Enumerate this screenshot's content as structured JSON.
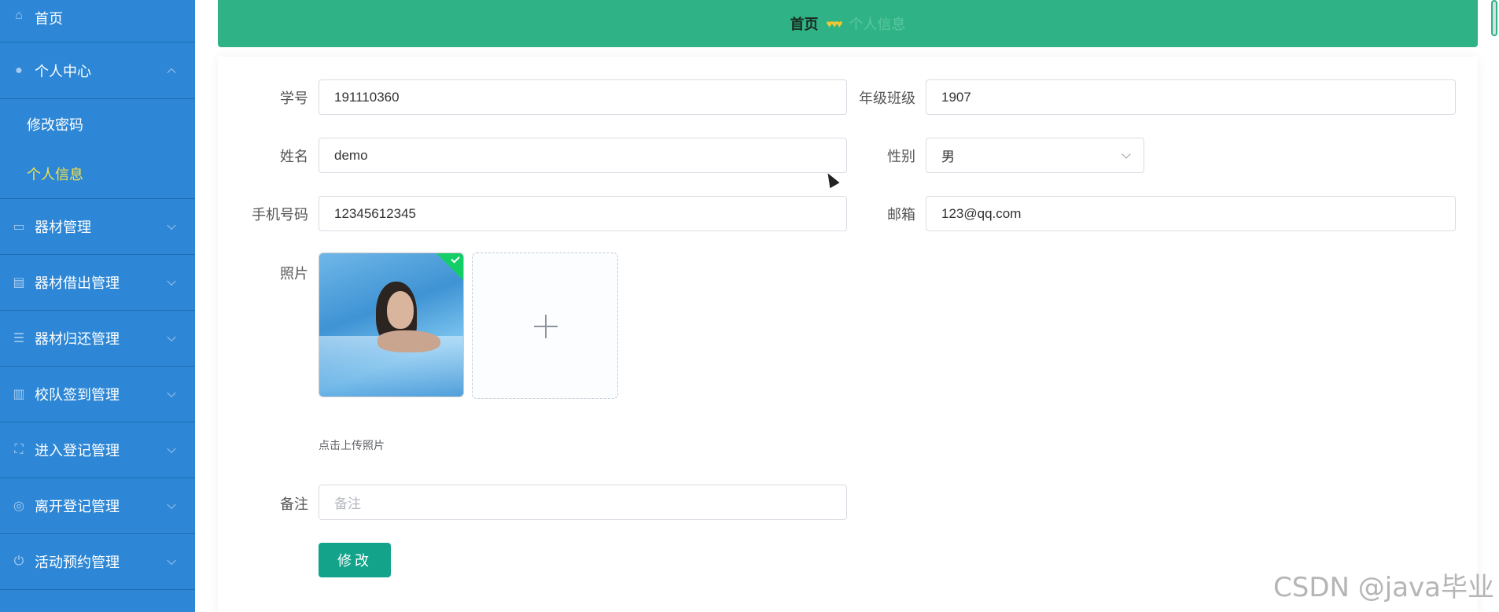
{
  "sidebar": {
    "items": [
      {
        "label": "首页",
        "icon": "home-icon"
      },
      {
        "label": "个人中心",
        "icon": "user-icon",
        "expanded": true,
        "children": [
          {
            "label": "修改密码"
          },
          {
            "label": "个人信息",
            "active": true
          }
        ]
      },
      {
        "label": "器材管理",
        "icon": "monitor-icon"
      },
      {
        "label": "器材借出管理",
        "icon": "clipboard-icon"
      },
      {
        "label": "器材归还管理",
        "icon": "sliders-icon"
      },
      {
        "label": "校队签到管理",
        "icon": "books-icon"
      },
      {
        "label": "进入登记管理",
        "icon": "fullscreen-icon"
      },
      {
        "label": "离开登记管理",
        "icon": "lifebuoy-icon"
      },
      {
        "label": "活动预约管理",
        "icon": "power-icon"
      }
    ]
  },
  "breadcrumb": {
    "home": "首页",
    "separator": "♥♥♥",
    "current": "个人信息"
  },
  "form": {
    "student_id": {
      "label": "学号",
      "value": "191110360"
    },
    "grade_class": {
      "label": "年级班级",
      "value": "1907"
    },
    "name": {
      "label": "姓名",
      "value": "demo"
    },
    "gender": {
      "label": "性别",
      "value": "男"
    },
    "phone": {
      "label": "手机号码",
      "value": "12345612345"
    },
    "email": {
      "label": "邮箱",
      "value": "123@qq.com"
    },
    "photo": {
      "label": "照片",
      "hint": "点击上传照片"
    },
    "remark": {
      "label": "备注",
      "placeholder": "备注"
    },
    "submit_label": "修改"
  },
  "watermark": "CSDN @java毕业",
  "colors": {
    "sidebar": "#2d87d6",
    "header": "#2fb386",
    "button": "#13a38a",
    "active_submenu": "#f3e24b"
  }
}
